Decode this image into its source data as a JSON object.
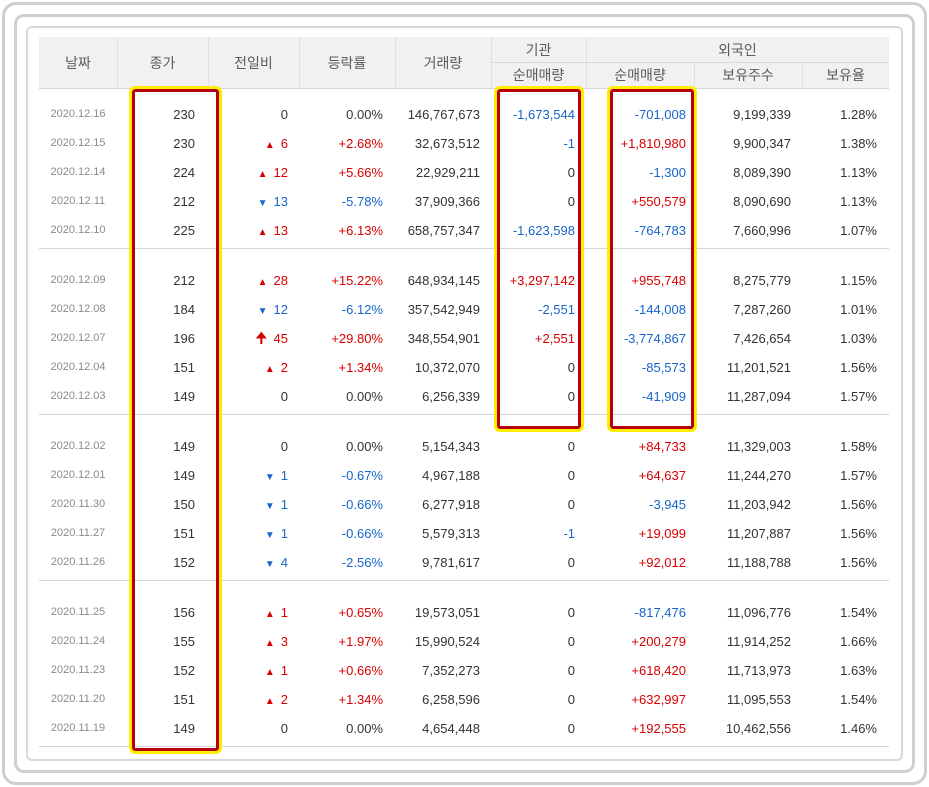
{
  "headers": {
    "date": "날짜",
    "close": "종가",
    "diff": "전일비",
    "rate": "등락률",
    "volume": "거래량",
    "institution": "기관",
    "institution_net": "순매매량",
    "foreign": "외국인",
    "foreign_net": "순매매량",
    "foreign_holdings": "보유주수",
    "foreign_ratio": "보유율"
  },
  "colors": {
    "up": "#d80000",
    "down": "#1765c9",
    "highlight_fill": "#ffee00",
    "highlight_border": "#b8000a"
  },
  "groups": [
    [
      {
        "date": "2020.12.16",
        "close": "230",
        "dir": "none",
        "diff": "0",
        "rate": "0.00%",
        "volume": "146,767,673",
        "inst": "-1,673,544",
        "frn": "-701,008",
        "hold": "9,199,339",
        "ratio": "1.28%"
      },
      {
        "date": "2020.12.15",
        "close": "230",
        "dir": "up",
        "diff": "6",
        "rate": "+2.68%",
        "volume": "32,673,512",
        "inst": "-1",
        "frn": "+1,810,980",
        "hold": "9,900,347",
        "ratio": "1.38%"
      },
      {
        "date": "2020.12.14",
        "close": "224",
        "dir": "up",
        "diff": "12",
        "rate": "+5.66%",
        "volume": "22,929,211",
        "inst": "0",
        "frn": "-1,300",
        "hold": "8,089,390",
        "ratio": "1.13%"
      },
      {
        "date": "2020.12.11",
        "close": "212",
        "dir": "down",
        "diff": "13",
        "rate": "-5.78%",
        "volume": "37,909,366",
        "inst": "0",
        "frn": "+550,579",
        "hold": "8,090,690",
        "ratio": "1.13%"
      },
      {
        "date": "2020.12.10",
        "close": "225",
        "dir": "up",
        "diff": "13",
        "rate": "+6.13%",
        "volume": "658,757,347",
        "inst": "-1,623,598",
        "frn": "-764,783",
        "hold": "7,660,996",
        "ratio": "1.07%"
      }
    ],
    [
      {
        "date": "2020.12.09",
        "close": "212",
        "dir": "up",
        "diff": "28",
        "rate": "+15.22%",
        "volume": "648,934,145",
        "inst": "+3,297,142",
        "frn": "+955,748",
        "hold": "8,275,779",
        "ratio": "1.15%"
      },
      {
        "date": "2020.12.08",
        "close": "184",
        "dir": "down",
        "diff": "12",
        "rate": "-6.12%",
        "volume": "357,542,949",
        "inst": "-2,551",
        "frn": "-144,008",
        "hold": "7,287,260",
        "ratio": "1.01%"
      },
      {
        "date": "2020.12.07",
        "close": "196",
        "dir": "limit",
        "diff": "45",
        "rate": "+29.80%",
        "volume": "348,554,901",
        "inst": "+2,551",
        "frn": "-3,774,867",
        "hold": "7,426,654",
        "ratio": "1.03%"
      },
      {
        "date": "2020.12.04",
        "close": "151",
        "dir": "up",
        "diff": "2",
        "rate": "+1.34%",
        "volume": "10,372,070",
        "inst": "0",
        "frn": "-85,573",
        "hold": "11,201,521",
        "ratio": "1.56%"
      },
      {
        "date": "2020.12.03",
        "close": "149",
        "dir": "none",
        "diff": "0",
        "rate": "0.00%",
        "volume": "6,256,339",
        "inst": "0",
        "frn": "-41,909",
        "hold": "11,287,094",
        "ratio": "1.57%"
      }
    ],
    [
      {
        "date": "2020.12.02",
        "close": "149",
        "dir": "none",
        "diff": "0",
        "rate": "0.00%",
        "volume": "5,154,343",
        "inst": "0",
        "frn": "+84,733",
        "hold": "11,329,003",
        "ratio": "1.58%"
      },
      {
        "date": "2020.12.01",
        "close": "149",
        "dir": "down",
        "diff": "1",
        "rate": "-0.67%",
        "volume": "4,967,188",
        "inst": "0",
        "frn": "+64,637",
        "hold": "11,244,270",
        "ratio": "1.57%"
      },
      {
        "date": "2020.11.30",
        "close": "150",
        "dir": "down",
        "diff": "1",
        "rate": "-0.66%",
        "volume": "6,277,918",
        "inst": "0",
        "frn": "-3,945",
        "hold": "11,203,942",
        "ratio": "1.56%"
      },
      {
        "date": "2020.11.27",
        "close": "151",
        "dir": "down",
        "diff": "1",
        "rate": "-0.66%",
        "volume": "5,579,313",
        "inst": "-1",
        "frn": "+19,099",
        "hold": "11,207,887",
        "ratio": "1.56%"
      },
      {
        "date": "2020.11.26",
        "close": "152",
        "dir": "down",
        "diff": "4",
        "rate": "-2.56%",
        "volume": "9,781,617",
        "inst": "0",
        "frn": "+92,012",
        "hold": "11,188,788",
        "ratio": "1.56%"
      }
    ],
    [
      {
        "date": "2020.11.25",
        "close": "156",
        "dir": "up",
        "diff": "1",
        "rate": "+0.65%",
        "volume": "19,573,051",
        "inst": "0",
        "frn": "-817,476",
        "hold": "11,096,776",
        "ratio": "1.54%"
      },
      {
        "date": "2020.11.24",
        "close": "155",
        "dir": "up",
        "diff": "3",
        "rate": "+1.97%",
        "volume": "15,990,524",
        "inst": "0",
        "frn": "+200,279",
        "hold": "11,914,252",
        "ratio": "1.66%"
      },
      {
        "date": "2020.11.23",
        "close": "152",
        "dir": "up",
        "diff": "1",
        "rate": "+0.66%",
        "volume": "7,352,273",
        "inst": "0",
        "frn": "+618,420",
        "hold": "11,713,973",
        "ratio": "1.63%"
      },
      {
        "date": "2020.11.20",
        "close": "151",
        "dir": "up",
        "diff": "2",
        "rate": "+1.34%",
        "volume": "6,258,596",
        "inst": "0",
        "frn": "+632,997",
        "hold": "11,095,553",
        "ratio": "1.54%"
      },
      {
        "date": "2020.11.19",
        "close": "149",
        "dir": "none",
        "diff": "0",
        "rate": "0.00%",
        "volume": "4,654,448",
        "inst": "0",
        "frn": "+192,555",
        "hold": "10,462,556",
        "ratio": "1.46%"
      }
    ]
  ]
}
